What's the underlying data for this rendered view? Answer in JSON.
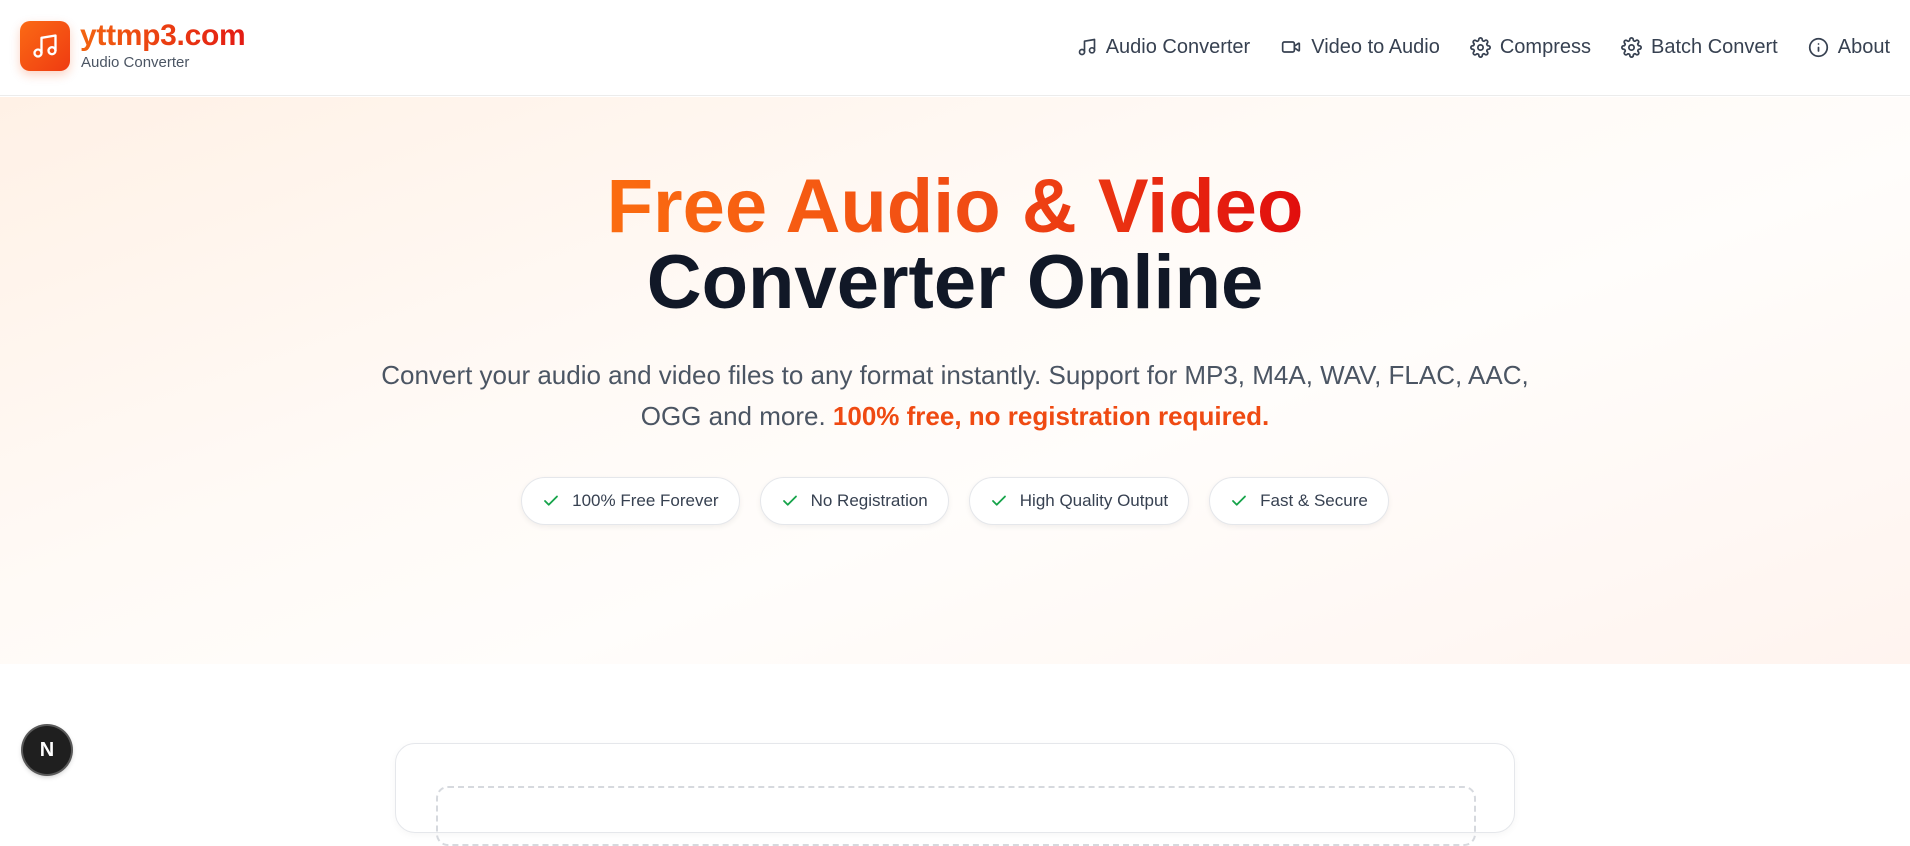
{
  "brand": {
    "name": "yttmp3.com",
    "subtitle": "Audio Converter",
    "logo_icon": "music-note-icon"
  },
  "nav": [
    {
      "label": "Audio Converter",
      "icon": "music-note-icon"
    },
    {
      "label": "Video to Audio",
      "icon": "video-camera-icon"
    },
    {
      "label": "Compress",
      "icon": "gear-icon"
    },
    {
      "label": "Batch Convert",
      "icon": "gear-icon"
    },
    {
      "label": "About",
      "icon": "info-icon"
    }
  ],
  "hero": {
    "title_line1": "Free Audio & Video",
    "title_line2": "Converter Online",
    "description": "Convert your audio and video files to any format instantly. Support for MP3, M4A, WAV, FLAC, AAC, OGG and more. ",
    "description_highlight": "100% free, no registration required."
  },
  "badges": [
    {
      "label": "100% Free Forever"
    },
    {
      "label": "No Registration"
    },
    {
      "label": "High Quality Output"
    },
    {
      "label": "Fast & Secure"
    }
  ],
  "fab": {
    "label": "N"
  },
  "colors": {
    "accent_start": "#fb6c10",
    "accent_end": "#e10d0d",
    "check_green": "#16a34a",
    "heading_dark": "#111827"
  }
}
